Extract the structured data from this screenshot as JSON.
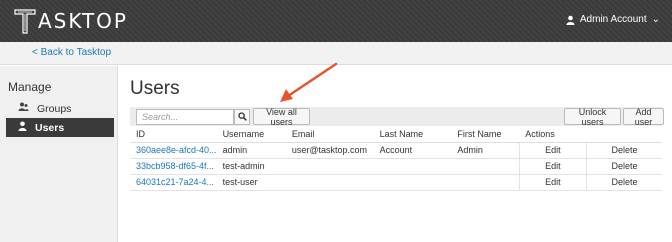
{
  "header": {
    "logo_text": "ASKTOP",
    "logo_icon": "tasktop-t-icon",
    "account_label": "Admin Account",
    "account_chevron": "⌄"
  },
  "subnav": {
    "back_label": "< Back to Tasktop"
  },
  "sidebar": {
    "section_title": "Manage",
    "items": [
      {
        "label": "Groups",
        "icon": "groups-icon",
        "active": false
      },
      {
        "label": "Users",
        "icon": "user-icon",
        "active": true
      }
    ]
  },
  "main": {
    "title": "Users",
    "search": {
      "placeholder": "Search...",
      "value": ""
    },
    "buttons": {
      "view_all": "View all users",
      "unlock": "Unlock users",
      "add": "Add user"
    },
    "table": {
      "columns": [
        "ID",
        "Username",
        "Email",
        "Last Name",
        "First Name",
        "Actions"
      ],
      "rows": [
        {
          "id": "360aee8e-afcd-40...",
          "username": "admin",
          "email": "user@tasktop.com",
          "last_name": "Account",
          "first_name": "Admin",
          "edit": "Edit",
          "delete": "Delete"
        },
        {
          "id": "33bcb958-df65-4f...",
          "username": "test-admin",
          "email": "",
          "last_name": "",
          "first_name": "",
          "edit": "Edit",
          "delete": "Delete"
        },
        {
          "id": "64031c21-7a24-4...",
          "username": "test-user",
          "email": "",
          "last_name": "",
          "first_name": "",
          "edit": "Edit",
          "delete": "Delete"
        }
      ]
    }
  },
  "annotation": {
    "arrow_color": "#e8542a"
  },
  "colors": {
    "link": "#1a7ab8",
    "header_bg": "#3c3c3c",
    "active_nav_bg": "#3a3a3a"
  }
}
